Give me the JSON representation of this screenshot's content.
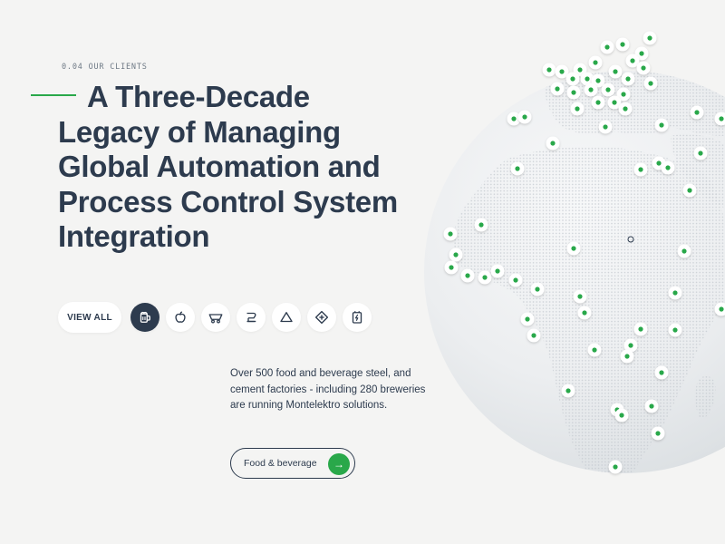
{
  "section": {
    "eyebrow": "0.04 OUR CLIENTS",
    "headline": {
      "part1": "A Three-Decade",
      "part2": "Legacy of ",
      "bold1": "Managing",
      "bold2": "Global Automation",
      "part3": " and",
      "part4": "Process Control System",
      "part5": "Integration"
    }
  },
  "categories": {
    "view_all_label": "VIEW ALL",
    "items": [
      {
        "icon": "beer-mug-icon",
        "active": true
      },
      {
        "icon": "apple-icon",
        "active": false
      },
      {
        "icon": "mining-cart-icon",
        "active": false
      },
      {
        "icon": "bread-mixer-icon",
        "active": false
      },
      {
        "icon": "triangle-icon",
        "active": false
      },
      {
        "icon": "diamond-plus-icon",
        "active": false
      },
      {
        "icon": "battery-power-icon",
        "active": false
      }
    ]
  },
  "description": "Over 500 food and beverage steel, and cement factories - including 280 breweries  are running Montelektro solutions.",
  "cta": {
    "label": "Food & beverage",
    "arrow": "→"
  },
  "colors": {
    "accent": "#29a84a",
    "text": "#2d3b4e",
    "background": "#f4f4f3"
  }
}
